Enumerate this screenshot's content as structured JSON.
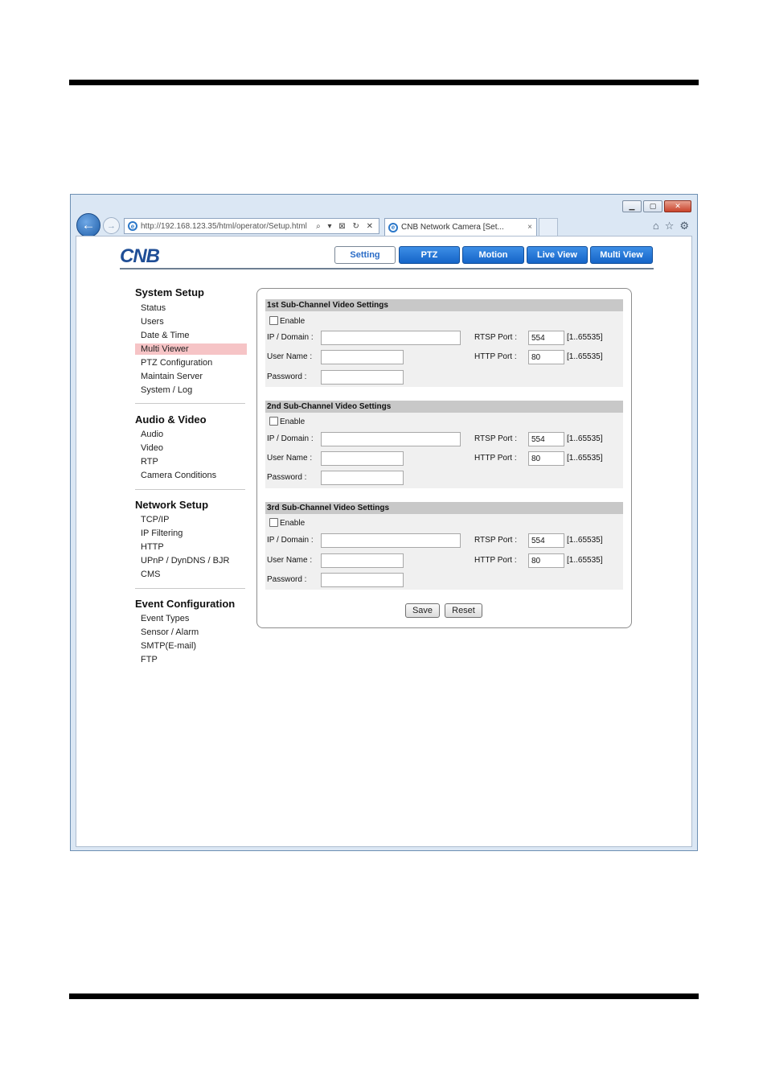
{
  "browser": {
    "url": "http://192.168.123.35/html/operator/Setup.html",
    "tab_title": "CNB Network Camera [Set...",
    "tab_close": "×",
    "address_tools": "⌕ ▾ ⊠ ↻ ✕"
  },
  "logo": {
    "text": "CNB",
    "color": "#1f4e96"
  },
  "nav": {
    "setting": "Setting",
    "ptz": "PTZ",
    "motion": "Motion",
    "live_view": "Live View",
    "multi_view": "Multi View"
  },
  "sidebar": {
    "system_setup": {
      "title": "System Setup",
      "items": [
        "Status",
        "Users",
        "Date & Time",
        "Multi Viewer",
        "PTZ Configuration",
        "Maintain Server",
        "System / Log"
      ]
    },
    "audio_video": {
      "title": "Audio & Video",
      "items": [
        "Audio",
        "Video",
        "RTP",
        "Camera Conditions"
      ]
    },
    "network_setup": {
      "title": "Network Setup",
      "items": [
        "TCP/IP",
        "IP Filtering",
        "HTTP",
        "UPnP / DynDNS / BJR",
        "CMS"
      ]
    },
    "event_configuration": {
      "title": "Event Configuration",
      "items": [
        "Event Types",
        "Sensor / Alarm",
        "SMTP(E-mail)",
        "FTP"
      ]
    }
  },
  "form": {
    "labels": {
      "enable": "Enable",
      "ip_domain": "IP / Domain :",
      "user_name": "User Name :",
      "password": "Password :",
      "rtsp_port": "RTSP Port :",
      "http_port": "HTTP Port :",
      "range": "[1..65535]"
    },
    "sections": [
      {
        "title": "1st Sub-Channel Video Settings",
        "rtsp_port": "554",
        "http_port": "80"
      },
      {
        "title": "2nd Sub-Channel Video Settings",
        "rtsp_port": "554",
        "http_port": "80"
      },
      {
        "title": "3rd Sub-Channel Video Settings",
        "rtsp_port": "554",
        "http_port": "80"
      }
    ],
    "save": "Save",
    "reset": "Reset"
  }
}
